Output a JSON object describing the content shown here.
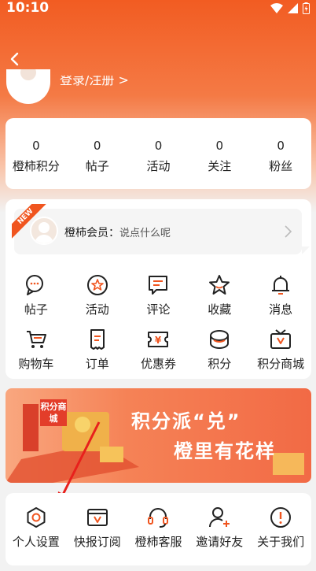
{
  "status_bar": {
    "time": "10:10"
  },
  "header": {
    "login_text": "登录/注册 >"
  },
  "stats": [
    {
      "value": "0",
      "label": "橙柿积分"
    },
    {
      "value": "0",
      "label": "帖子"
    },
    {
      "value": "0",
      "label": "活动"
    },
    {
      "value": "0",
      "label": "关注"
    },
    {
      "value": "0",
      "label": "粉丝"
    }
  ],
  "vip": {
    "badge": "NEW",
    "title": "橙柿会员：",
    "subtitle": "说点什么呢"
  },
  "grid_row1": [
    {
      "label": "帖子",
      "icon": "chat-icon"
    },
    {
      "label": "活动",
      "icon": "star-circle-icon"
    },
    {
      "label": "评论",
      "icon": "comment-icon"
    },
    {
      "label": "收藏",
      "icon": "star-icon"
    },
    {
      "label": "消息",
      "icon": "bell-icon"
    }
  ],
  "grid_row2": [
    {
      "label": "购物车",
      "icon": "cart-icon"
    },
    {
      "label": "订单",
      "icon": "order-icon"
    },
    {
      "label": "优惠券",
      "icon": "coupon-icon"
    },
    {
      "label": "积分",
      "icon": "points-icon"
    },
    {
      "label": "积分商城",
      "icon": "points-mall-icon"
    }
  ],
  "banner": {
    "line1": "积分派“兑”",
    "line2": "橙里有花样",
    "sign_text": "积分商城"
  },
  "bottom_row": [
    {
      "label": "个人设置",
      "icon": "settings-icon"
    },
    {
      "label": "快报订阅",
      "icon": "subscribe-icon"
    },
    {
      "label": "橙柿客服",
      "icon": "headset-icon"
    },
    {
      "label": "邀请好友",
      "icon": "invite-icon"
    },
    {
      "label": "关于我们",
      "icon": "info-icon"
    }
  ],
  "colors": {
    "accent": "#f25c22",
    "icon_orange": "#f0551f"
  }
}
